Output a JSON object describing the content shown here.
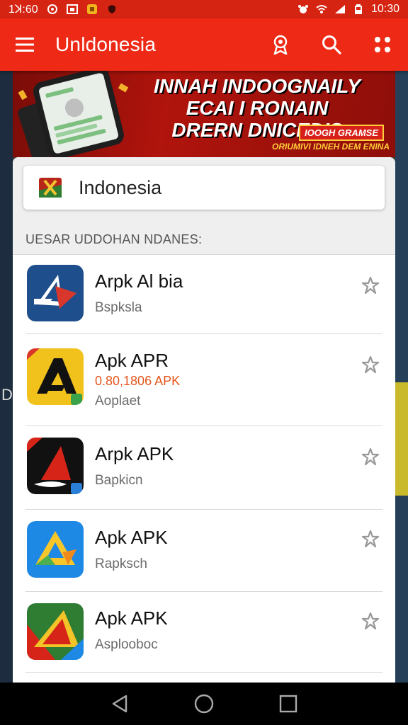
{
  "status_bar": {
    "time_left": "1ꓘ:60",
    "time_right": "10:30",
    "icons": [
      "notification-icon",
      "photo-icon",
      "app-badge-icon",
      "shield-icon",
      "alarm-icon",
      "wifi-icon",
      "signal-icon",
      "battery-icon"
    ]
  },
  "app_bar": {
    "title": "Unldonesia",
    "actions": [
      "award-icon",
      "search-icon",
      "more-icon"
    ]
  },
  "banner": {
    "lines": [
      "INNAH INDOOGNAILY",
      "ECAI I RONAIN",
      "DRERN DNICEDIS"
    ],
    "tag": "IOOGH GRAMSE",
    "fine_print": "ORIUMIVI IDNEH DEM ENINA"
  },
  "country_selector": {
    "label": "Indonesia"
  },
  "section": {
    "header": "UESAR UDDOHAN NDANES:"
  },
  "apps": [
    {
      "name": "Arpk Al bia",
      "version": "",
      "sub": "Bspksla",
      "icon": "blue-a-icon"
    },
    {
      "name": "Apk APR",
      "version": "0.80,1806 APK",
      "sub": "Aoplaet",
      "icon": "yellow-a-icon"
    },
    {
      "name": "Arpk APK",
      "version": "",
      "sub": "Bapkicn",
      "icon": "red-black-a-icon"
    },
    {
      "name": "Apk APK",
      "version": "",
      "sub": "Rapksch",
      "icon": "blue-yellow-a-icon"
    },
    {
      "name": "Apk APK",
      "version": "",
      "sub": "Asplooboc",
      "icon": "multicolor-a-icon"
    }
  ],
  "side_char": "D",
  "colors": {
    "app_bar": "#ee2a16",
    "status_bar": "#d62412",
    "version_text": "#e2561c"
  }
}
